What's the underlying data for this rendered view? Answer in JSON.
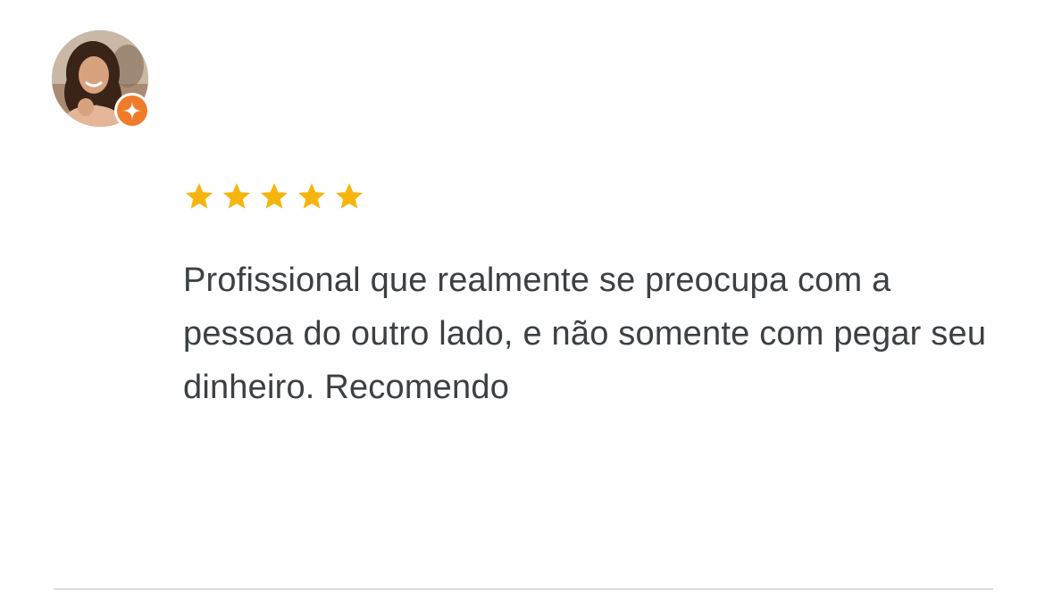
{
  "review": {
    "avatar": {
      "description_icon": "user-avatar-photo",
      "badge_icon": "local-guide-badge-icon",
      "badge_color": "#f07b2a"
    },
    "rating": 5,
    "rating_max": 5,
    "star_color": "#f6b50e",
    "text": "Profissional que realmente se preocupa com a pessoa do outro lado, e não somente com pegar seu dinheiro. Recomendo"
  }
}
